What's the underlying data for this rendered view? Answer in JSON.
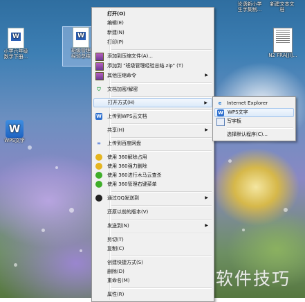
{
  "desktop": {
    "icons": [
      {
        "id": "d1",
        "label": "小学六年级\n数学下册..."
      },
      {
        "id": "d2",
        "label": "班级管理\n经验总结"
      },
      {
        "id": "d3",
        "label": "WPS文字"
      },
      {
        "id": "d4",
        "label": "论语新小学\n生字集制..."
      },
      {
        "id": "d5",
        "label": "新建文本文\n档"
      },
      {
        "id": "d6",
        "label": "N2 FRA[JI]..."
      }
    ],
    "watermark": "软件技巧"
  },
  "context_menu": {
    "items": [
      {
        "label": "打开(O)",
        "bold": true
      },
      {
        "label": "编辑(E)"
      },
      {
        "label": "新建(N)"
      },
      {
        "label": "打印(P)"
      },
      {
        "label": "添加到压缩文件(A)...",
        "icon": "archive-icon"
      },
      {
        "label": "添加到 \"班级管理经验总结.zip\" (T)",
        "icon": "archive-icon"
      },
      {
        "label": "其他压缩命令",
        "icon": "archive-icon",
        "submenu": true
      },
      {
        "label": "文档加密/解密",
        "icon": "shield-icon"
      },
      {
        "label": "打开方式(H)",
        "submenu": true,
        "highlighted": true
      },
      {
        "label": "上传到WPS云文档",
        "icon": "wps-cloud-icon"
      },
      {
        "label": "共享(H)",
        "submenu": true
      },
      {
        "label": "上传到百度网盘",
        "icon": "baidu-icon"
      },
      {
        "label": "使用 360解除占用",
        "icon": "360-icon"
      },
      {
        "label": "使用 360强力删除",
        "icon": "360-icon"
      },
      {
        "label": "使用 360进行木马云查杀",
        "icon": "360-icon"
      },
      {
        "label": "使用 360管理右键菜单",
        "icon": "360-icon"
      },
      {
        "label": "通过QQ发送到",
        "icon": "qq-icon",
        "submenu": true
      },
      {
        "label": "还原以前的版本(V)"
      },
      {
        "label": "发送到(N)",
        "submenu": true
      },
      {
        "label": "剪切(T)"
      },
      {
        "label": "复制(C)"
      },
      {
        "label": "创建快捷方式(S)"
      },
      {
        "label": "删除(D)"
      },
      {
        "label": "重命名(M)"
      },
      {
        "label": "属性(R)"
      }
    ]
  },
  "open_with_submenu": {
    "items": [
      {
        "label": "Internet Explorer",
        "icon": "ie-icon"
      },
      {
        "label": "WPS文字",
        "icon": "wps-icon",
        "highlighted": true
      },
      {
        "label": "写字板",
        "icon": "wordpad-icon"
      },
      {
        "label": "选择默认程序(C)..."
      }
    ]
  },
  "colors": {
    "menu_bg": "#f0f0f0",
    "highlight": "#dceaf9",
    "highlight_border": "#a8c8ee"
  }
}
